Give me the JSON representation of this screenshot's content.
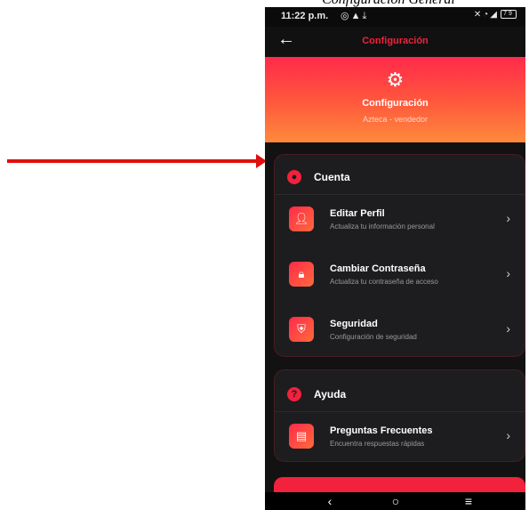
{
  "document": {
    "caption": "Configuración General"
  },
  "status_bar": {
    "time": "11:22 p.m.",
    "left_icons": [
      "whatsapp-icon",
      "warning-icon",
      "download-icon"
    ],
    "right_icons": [
      "mute-icon",
      "wifi-icon",
      "signal-icon"
    ],
    "battery": "79"
  },
  "app_bar": {
    "title": "Configuración",
    "back_icon": "arrow-left-icon"
  },
  "header": {
    "icon": "gear-icon",
    "title": "Configuración",
    "subtitle": "Azteca - vendedor"
  },
  "sections": [
    {
      "title": "Cuenta",
      "icon": "account-circle-icon",
      "items": [
        {
          "title": "Editar Perfil",
          "subtitle": "Actualiza tu información personal",
          "icon": "person-icon"
        },
        {
          "title": "Cambiar Contraseña",
          "subtitle": "Actualiza tu contraseña de acceso",
          "icon": "lock-icon"
        },
        {
          "title": "Seguridad",
          "subtitle": "Configuración de seguridad",
          "icon": "shield-icon"
        }
      ]
    },
    {
      "title": "Ayuda",
      "icon": "help-circle-icon",
      "items": [
        {
          "title": "Preguntas Frecuentes",
          "subtitle": "Encuentra respuestas rápidas",
          "icon": "chat-icon"
        }
      ]
    }
  ],
  "nav": [
    "back-nav-icon",
    "home-nav-icon",
    "menu-nav-icon"
  ],
  "colors": {
    "accent": "#f2213c",
    "header_gradient_top": "#ff2a4a",
    "header_gradient_bottom": "#ff8a3c",
    "background": "#121212",
    "card": "#1d1d1f",
    "annotation_arrow": "#e00e0e"
  }
}
